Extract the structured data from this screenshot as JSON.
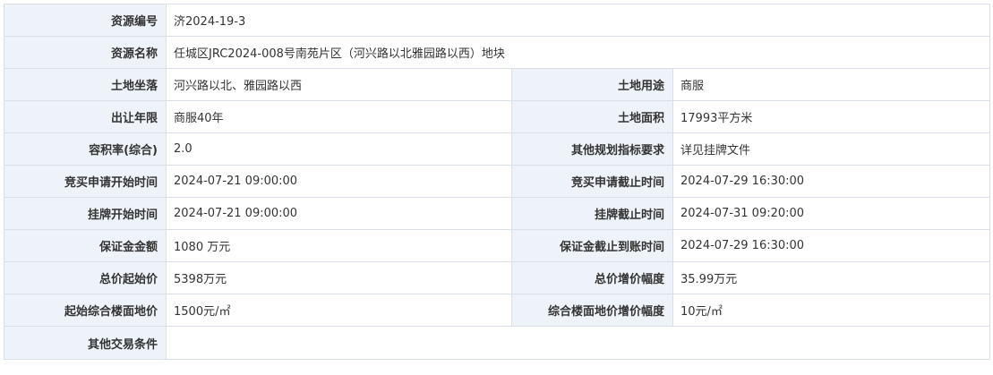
{
  "rows": [
    {
      "label": "资源编号",
      "value": "济2024-19-3"
    },
    {
      "label": "资源名称",
      "value": "任城区JRC2024-008号南苑片区（河兴路以北雅园路以西）地块"
    },
    {
      "label": "土地坐落",
      "value": "河兴路以北、雅园路以西",
      "label2": "土地用途",
      "value2": "商服"
    },
    {
      "label": "出让年限",
      "value": "商服40年",
      "label2": "土地面积",
      "value2": "17993平方米"
    },
    {
      "label": "容积率(综合)",
      "value": "2.0",
      "label2": "其他规划指标要求",
      "value2": "详见挂牌文件"
    },
    {
      "label": "竞买申请开始时间",
      "value": "2024-07-21 09:00:00",
      "label2": "竞买申请截止时间",
      "value2": "2024-07-29 16:30:00"
    },
    {
      "label": "挂牌开始时间",
      "value": "2024-07-21 09:00:00",
      "label2": "挂牌截止时间",
      "value2": "2024-07-31 09:20:00"
    },
    {
      "label": "保证金金额",
      "value": "1080 万元",
      "label2": "保证金截止到账时间",
      "value2": "2024-07-29 16:30:00"
    },
    {
      "label": "总价起始价",
      "value": "5398万元",
      "label2": "总价增价幅度",
      "value2": "35.99万元"
    },
    {
      "label": "起始综合楼面地价",
      "value": "1500元/㎡",
      "label2": "综合楼面地价增价幅度",
      "value2": "10元/㎡"
    },
    {
      "label": "其他交易条件",
      "value": ""
    }
  ]
}
